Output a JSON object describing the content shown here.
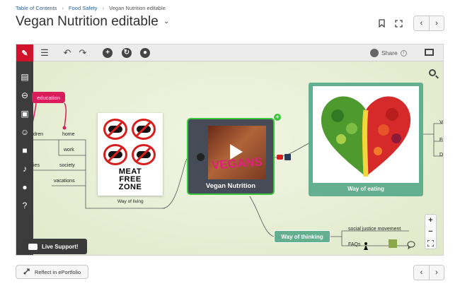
{
  "breadcrumbs": [
    "Table of Contents",
    "Food Safety",
    "Vegan Nutrition editable"
  ],
  "page_title": "Vegan Nutrition editable",
  "share_label": "Share",
  "map": {
    "education_label": "education",
    "home_label": "home",
    "work_label": "work",
    "society_label": "society",
    "vacations_label": "vacations",
    "children_partial": "dren",
    "ies_partial": "ies",
    "meat_text": [
      "MEAT",
      "FREE",
      "ZONE"
    ],
    "way_of_living": "Way of living",
    "vegan_video_word": "VEGANS",
    "vegan_nutrition": "Vegan Nutrition",
    "way_of_eating": "Way of eating",
    "way_of_thinking": "Way of thinking",
    "social_justice": "social justice movement",
    "faqs": "FAQs",
    "right_partials": [
      "Ve",
      "Fr",
      "Da"
    ]
  },
  "live_support": "Live Support!",
  "reflect_label": "Reflect in ePortfolio",
  "icons": {
    "prev": "‹",
    "next": "›"
  },
  "colors": {
    "brand_red": "#d0122a",
    "education_pink": "#d81d5a",
    "node_green": "#65af91",
    "selection_green": "#3ac83a"
  }
}
